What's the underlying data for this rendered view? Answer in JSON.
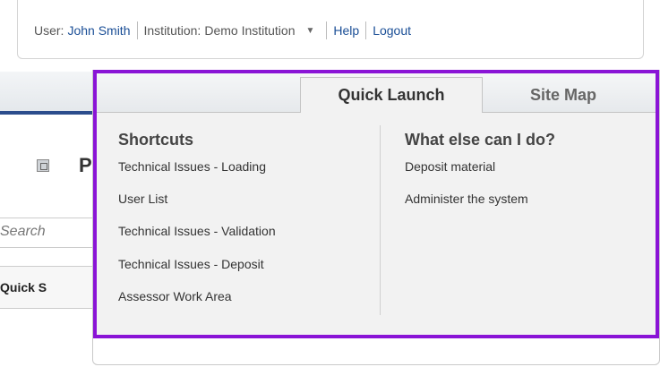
{
  "userbar": {
    "user_label": "User:",
    "user_name": "John Smith",
    "institution_label": "Institution:",
    "institution_name": "Demo Institution",
    "help": "Help",
    "logout": "Logout"
  },
  "background_page": {
    "title_fragment": "P",
    "search_placeholder": "Search",
    "quick_label": "Quick S"
  },
  "panel": {
    "tabs": [
      {
        "label": "Quick Launch",
        "active": true
      },
      {
        "label": "Site Map",
        "active": false
      }
    ],
    "shortcuts": {
      "heading": "Shortcuts",
      "items": [
        "Technical Issues - Loading",
        "User List",
        "Technical Issues - Validation",
        "Technical Issues - Deposit",
        "Assessor Work Area"
      ]
    },
    "what_else": {
      "heading": "What else can I do?",
      "items": [
        "Deposit material",
        "Administer the system"
      ]
    }
  },
  "colors": {
    "highlight": "#8a14d6",
    "link": "#1a4e96",
    "nav_accent": "#2b4d8c"
  }
}
